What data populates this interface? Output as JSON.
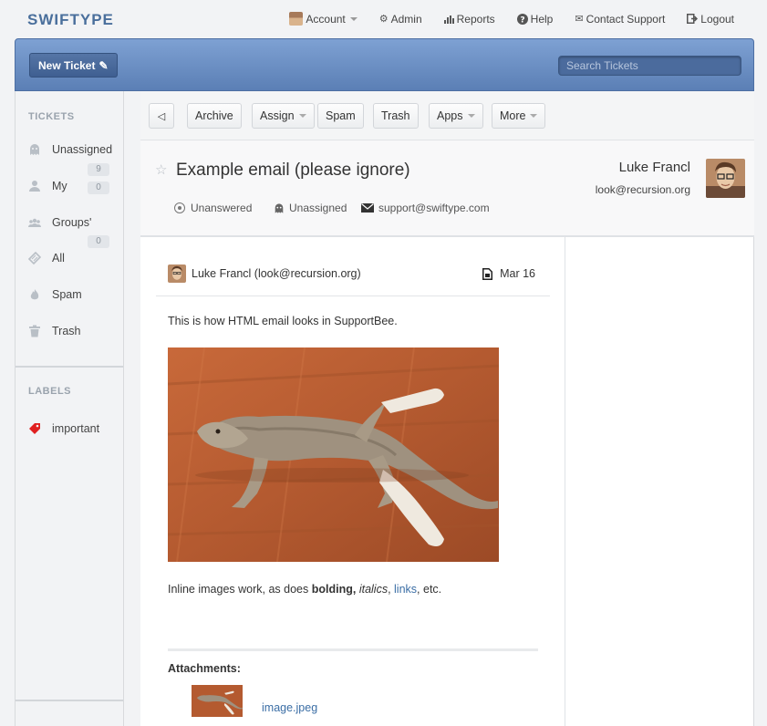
{
  "app": {
    "logo": "SWIFTYPE"
  },
  "topnav": {
    "account": "Account",
    "admin": "Admin",
    "reports": "Reports",
    "help": "Help",
    "contact": "Contact Support",
    "logout": "Logout"
  },
  "header": {
    "new_ticket": "New Ticket",
    "search_placeholder": "Search Tickets"
  },
  "sidebar": {
    "tickets_title": "TICKETS",
    "items": [
      {
        "label": "Unassigned",
        "icon": "ghost-icon"
      },
      {
        "label": "My",
        "icon": "user-icon",
        "count": "9"
      },
      {
        "label": "Groups'",
        "icon": "group-icon",
        "count": "0"
      },
      {
        "label": "All",
        "icon": "tickets-icon",
        "count": "0"
      },
      {
        "label": "Spam",
        "icon": "flame-icon"
      },
      {
        "label": "Trash",
        "icon": "trash-icon"
      }
    ],
    "labels_title": "LABELS",
    "labels": [
      {
        "label": "important",
        "icon": "tag-icon",
        "color": "#e02020"
      }
    ]
  },
  "toolbar": {
    "back": "◁",
    "archive": "Archive",
    "assign": "Assign",
    "spam": "Spam",
    "trash": "Trash",
    "apps": "Apps",
    "more": "More"
  },
  "ticket": {
    "title": "Example email (please ignore)",
    "status": "Unanswered",
    "assignee": "Unassigned",
    "mailbox": "support@swiftype.com",
    "requester_name": "Luke Francl",
    "requester_email": "look@recursion.org"
  },
  "message": {
    "from": "Luke Francl (look@recursion.org)",
    "date": "Mar 16",
    "line1": "This is how HTML email looks in SupportBee.",
    "line2_prefix": "Inline images work, as does ",
    "line2_bold": "bolding,",
    "line2_mid": " ",
    "line2_italic": "italics",
    "line2_sep": ", ",
    "line2_link": "links",
    "line2_suffix": ", etc.",
    "attachments_title": "Attachments:",
    "attachment_name": "image.jpeg"
  },
  "colors": {
    "brand": "#4a6f9c",
    "link": "#3b6ea5",
    "label_important": "#e02020"
  }
}
